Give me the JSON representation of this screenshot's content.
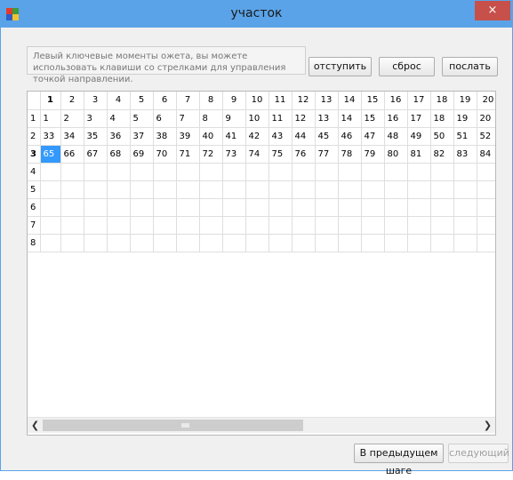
{
  "window": {
    "title": "участок",
    "close_label": "×"
  },
  "hint": "Левый ключевые моменты ожета, вы можете использовать клавиши со стрелками для управления точкой направлении.",
  "toolbar": {
    "indent_label": "отступить",
    "reset_label": "сброс",
    "send_label": "послать"
  },
  "grid": {
    "columns": [
      "1",
      "2",
      "3",
      "4",
      "5",
      "6",
      "7",
      "8",
      "9",
      "10",
      "11",
      "12",
      "13",
      "14",
      "15",
      "16",
      "17",
      "18",
      "19",
      "20"
    ],
    "rows": [
      {
        "header": "1",
        "cells": [
          "1",
          "2",
          "3",
          "4",
          "5",
          "6",
          "7",
          "8",
          "9",
          "10",
          "11",
          "12",
          "13",
          "14",
          "15",
          "16",
          "17",
          "18",
          "19",
          "20"
        ]
      },
      {
        "header": "2",
        "cells": [
          "33",
          "34",
          "35",
          "36",
          "37",
          "38",
          "39",
          "40",
          "41",
          "42",
          "43",
          "44",
          "45",
          "46",
          "47",
          "48",
          "49",
          "50",
          "51",
          "52"
        ]
      },
      {
        "header": "3",
        "cells": [
          "65",
          "66",
          "67",
          "68",
          "69",
          "70",
          "71",
          "72",
          "73",
          "74",
          "75",
          "76",
          "77",
          "78",
          "79",
          "80",
          "81",
          "82",
          "83",
          "84"
        ]
      },
      {
        "header": "4",
        "cells": []
      },
      {
        "header": "5",
        "cells": []
      },
      {
        "header": "6",
        "cells": []
      },
      {
        "header": "7",
        "cells": []
      },
      {
        "header": "8",
        "cells": []
      }
    ],
    "current_row": 3,
    "current_col": 1,
    "selected_cell": "65"
  },
  "footer": {
    "prev_label": "В предыдущем шаге",
    "next_label": "следующий"
  },
  "colors": {
    "titlebar": "#5aa3e8",
    "close": "#c7504a",
    "selection": "#3399ff"
  }
}
